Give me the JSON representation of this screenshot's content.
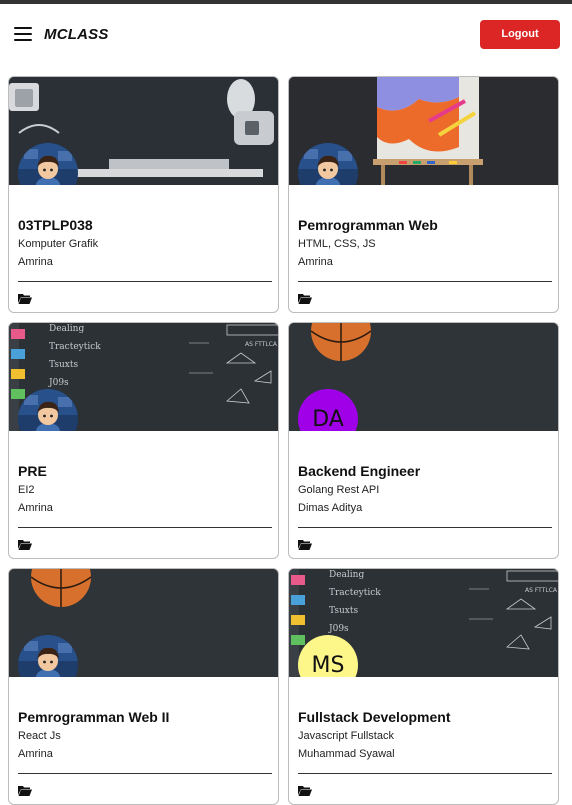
{
  "navbar": {
    "brand": "MCLASS",
    "logout_label": "Logout",
    "menu_icon": "hamburger-icon"
  },
  "colors": {
    "logout": "#dc2626",
    "avatar_da": "#a000e8",
    "avatar_ms": "#fdf78a"
  },
  "classes": [
    {
      "title": "03TPLP038",
      "subtitle": "Komputer Grafik",
      "teacher": "Amrina",
      "banner": "desk",
      "avatar": "image"
    },
    {
      "title": "Pemrogramman Web",
      "subtitle": "HTML, CSS, JS",
      "teacher": "Amrina",
      "banner": "easel",
      "avatar": "image"
    },
    {
      "title": "PRE",
      "subtitle": "EI2",
      "teacher": "Amrina",
      "banner": "chalkboard",
      "avatar": "image"
    },
    {
      "title": "Backend Engineer",
      "subtitle": "Golang Rest API",
      "teacher": "Dimas Aditya",
      "banner": "basketball",
      "avatar": "DA"
    },
    {
      "title": "Pemrogramman Web II",
      "subtitle": "React Js",
      "teacher": "Amrina",
      "banner": "basketball",
      "avatar": "image"
    },
    {
      "title": "Fullstack Development",
      "subtitle": "Javascript Fullstack",
      "teacher": "Muhammad Syawal",
      "banner": "chalkboard",
      "avatar": "MS"
    }
  ],
  "chalk": {
    "words": [
      "Dealing",
      "Tracteytick",
      "Tsuxts",
      "J09s",
      "AS FTTLCA"
    ]
  }
}
